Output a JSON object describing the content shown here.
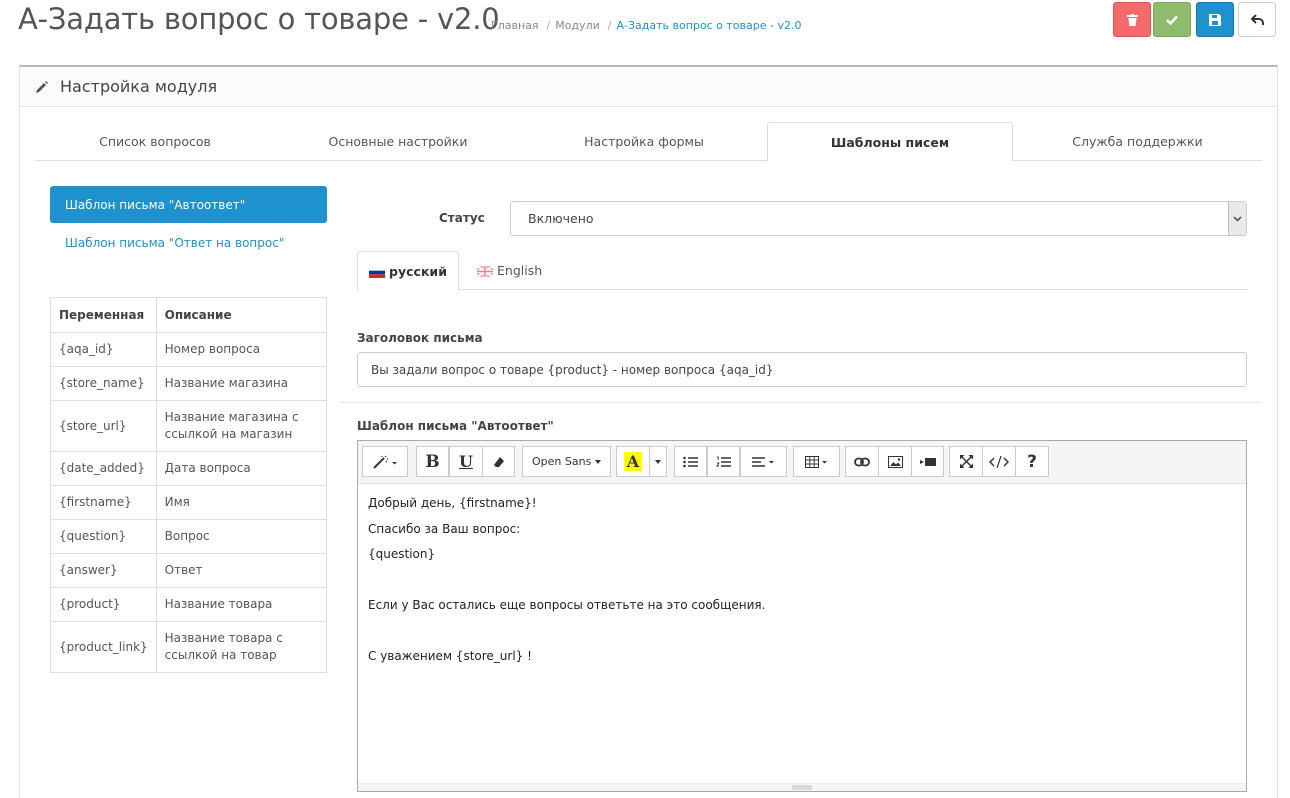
{
  "header": {
    "title": "А-Задать вопрос о товаре - v2.0",
    "breadcrumb": [
      "Главная",
      "Модули",
      "А-Задать вопрос о товаре - v2.0"
    ]
  },
  "panel": {
    "heading": "Настройка модуля"
  },
  "tabs": [
    "Список вопросов",
    "Основные настройки",
    "Настройка формы",
    "Шаблоны писем",
    "Служба поддержки"
  ],
  "active_tab": "Шаблоны писем",
  "templates": {
    "active": "Шаблон письма \"Автоответ\"",
    "other": "Шаблон письма \"Ответ на вопрос\""
  },
  "variables": {
    "headers": [
      "Переменная",
      "Описание"
    ],
    "rows": [
      [
        "{aqa_id}",
        "Номер вопроса"
      ],
      [
        "{store_name}",
        "Название магазина"
      ],
      [
        "{store_url}",
        "Название магазина с ссылкой на магазин"
      ],
      [
        "{date_added}",
        "Дата вопроса"
      ],
      [
        "{firstname}",
        "Имя"
      ],
      [
        "{question}",
        "Вопрос"
      ],
      [
        "{answer}",
        "Ответ"
      ],
      [
        "{product}",
        "Название товара"
      ],
      [
        "{product_link}",
        "Название товара с ссылкой на товар"
      ]
    ]
  },
  "form": {
    "status_label": "Статус",
    "status_value": "Включено",
    "languages": [
      "русский",
      "English"
    ],
    "subject_label": "Заголовок письма",
    "subject_value": "Вы задали вопрос о товаре {product} - номер вопроса {aqa_id}",
    "template_label": "Шаблон письма \"Автоответ\""
  },
  "editor": {
    "font_name": "Open Sans",
    "content": [
      "Добрый день, {firstname}!",
      "Спасибо за Ваш вопрос:",
      "{question}",
      "",
      "Если у Вас остались еще вопросы ответьте на это сообщения.",
      "",
      "С уважением {store_url} !"
    ]
  },
  "colors": {
    "primary": "#1e91cf",
    "delete": "#f56b6b",
    "save": "#8fbb6c"
  }
}
